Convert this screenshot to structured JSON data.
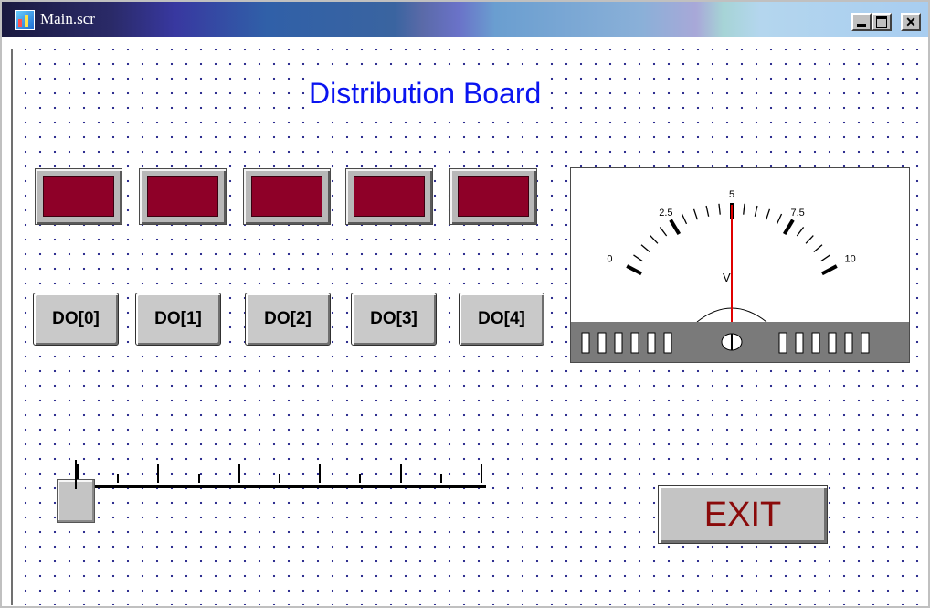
{
  "window": {
    "title": "Main.scr"
  },
  "page": {
    "title": "Distribution Board"
  },
  "lamps": [
    {
      "name": "lamp-0"
    },
    {
      "name": "lamp-1"
    },
    {
      "name": "lamp-2"
    },
    {
      "name": "lamp-3"
    },
    {
      "name": "lamp-4"
    }
  ],
  "lamp_color": "#8e0028",
  "do_buttons": [
    {
      "label": "DO[0]"
    },
    {
      "label": "DO[1]"
    },
    {
      "label": "DO[2]"
    },
    {
      "label": "DO[3]"
    },
    {
      "label": "DO[4]"
    }
  ],
  "meter": {
    "scale_labels": [
      "0",
      "2.5",
      "5",
      "7.5",
      "10"
    ],
    "unit": "V",
    "min": 0,
    "max": 10,
    "value": 5,
    "needle_color": "#e00000"
  },
  "slider": {
    "min": 0,
    "max": 10,
    "value": 0
  },
  "exit_button": {
    "label": "EXIT"
  },
  "colors": {
    "title_text": "#0a14f0",
    "exit_text": "#8a0a0a"
  }
}
